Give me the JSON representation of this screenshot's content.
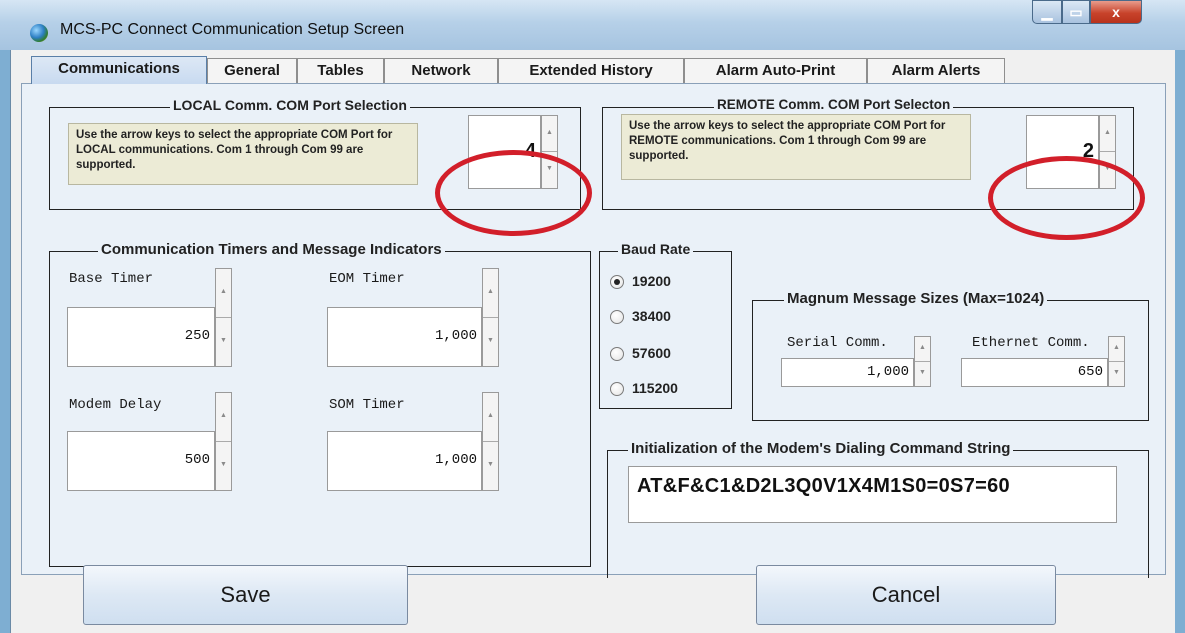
{
  "window": {
    "title": "MCS-PC Connect Communication Setup Screen",
    "minimize_glyph": "",
    "maximize_glyph": "",
    "close_glyph": "x"
  },
  "tabs": [
    {
      "label": "Communications",
      "active": true
    },
    {
      "label": "General"
    },
    {
      "label": "Tables"
    },
    {
      "label": "Network"
    },
    {
      "label": "Extended History"
    },
    {
      "label": "Alarm Auto-Print"
    },
    {
      "label": "Alarm Alerts"
    }
  ],
  "local_port": {
    "title": "LOCAL Comm. COM Port Selection",
    "hint": "Use the arrow keys to select the appropriate COM Port for LOCAL communications.  Com 1 through Com 99 are supported.",
    "value": "4"
  },
  "remote_port": {
    "title": "REMOTE Comm. COM Port Selecton",
    "hint": "Use the arrow keys to select the appropriate COM Port for REMOTE communications.  Com 1 through Com 99 are supported.",
    "value": "2"
  },
  "timers": {
    "title": "Communication Timers and Message Indicators",
    "base_timer": {
      "label": "Base Timer",
      "value": "250"
    },
    "eom_timer": {
      "label": "EOM Timer",
      "value": "1,000"
    },
    "modem_delay": {
      "label": "Modem Delay",
      "value": "500"
    },
    "som_timer": {
      "label": "SOM Timer",
      "value": "1,000"
    }
  },
  "baud_rate": {
    "title": "Baud Rate",
    "options": [
      "19200",
      "38400",
      "57600",
      "115200"
    ],
    "selected": "19200"
  },
  "magnum": {
    "title": "Magnum Message Sizes (Max=1024)",
    "serial": {
      "label": "Serial Comm.",
      "value": "1,000"
    },
    "ethernet": {
      "label": "Ethernet Comm.",
      "value": "650"
    }
  },
  "modem_init": {
    "title": "Initialization of the Modem's Dialing Command String",
    "value": "AT&F&C1&D2L3Q0V1X4M1S0=0S7=60"
  },
  "buttons": {
    "save": "Save",
    "cancel": "Cancel"
  },
  "colors": {
    "highlight_ring": "#d21f2a",
    "hint_background": "#ecebd6",
    "panel_background": "#eaf1f8"
  }
}
